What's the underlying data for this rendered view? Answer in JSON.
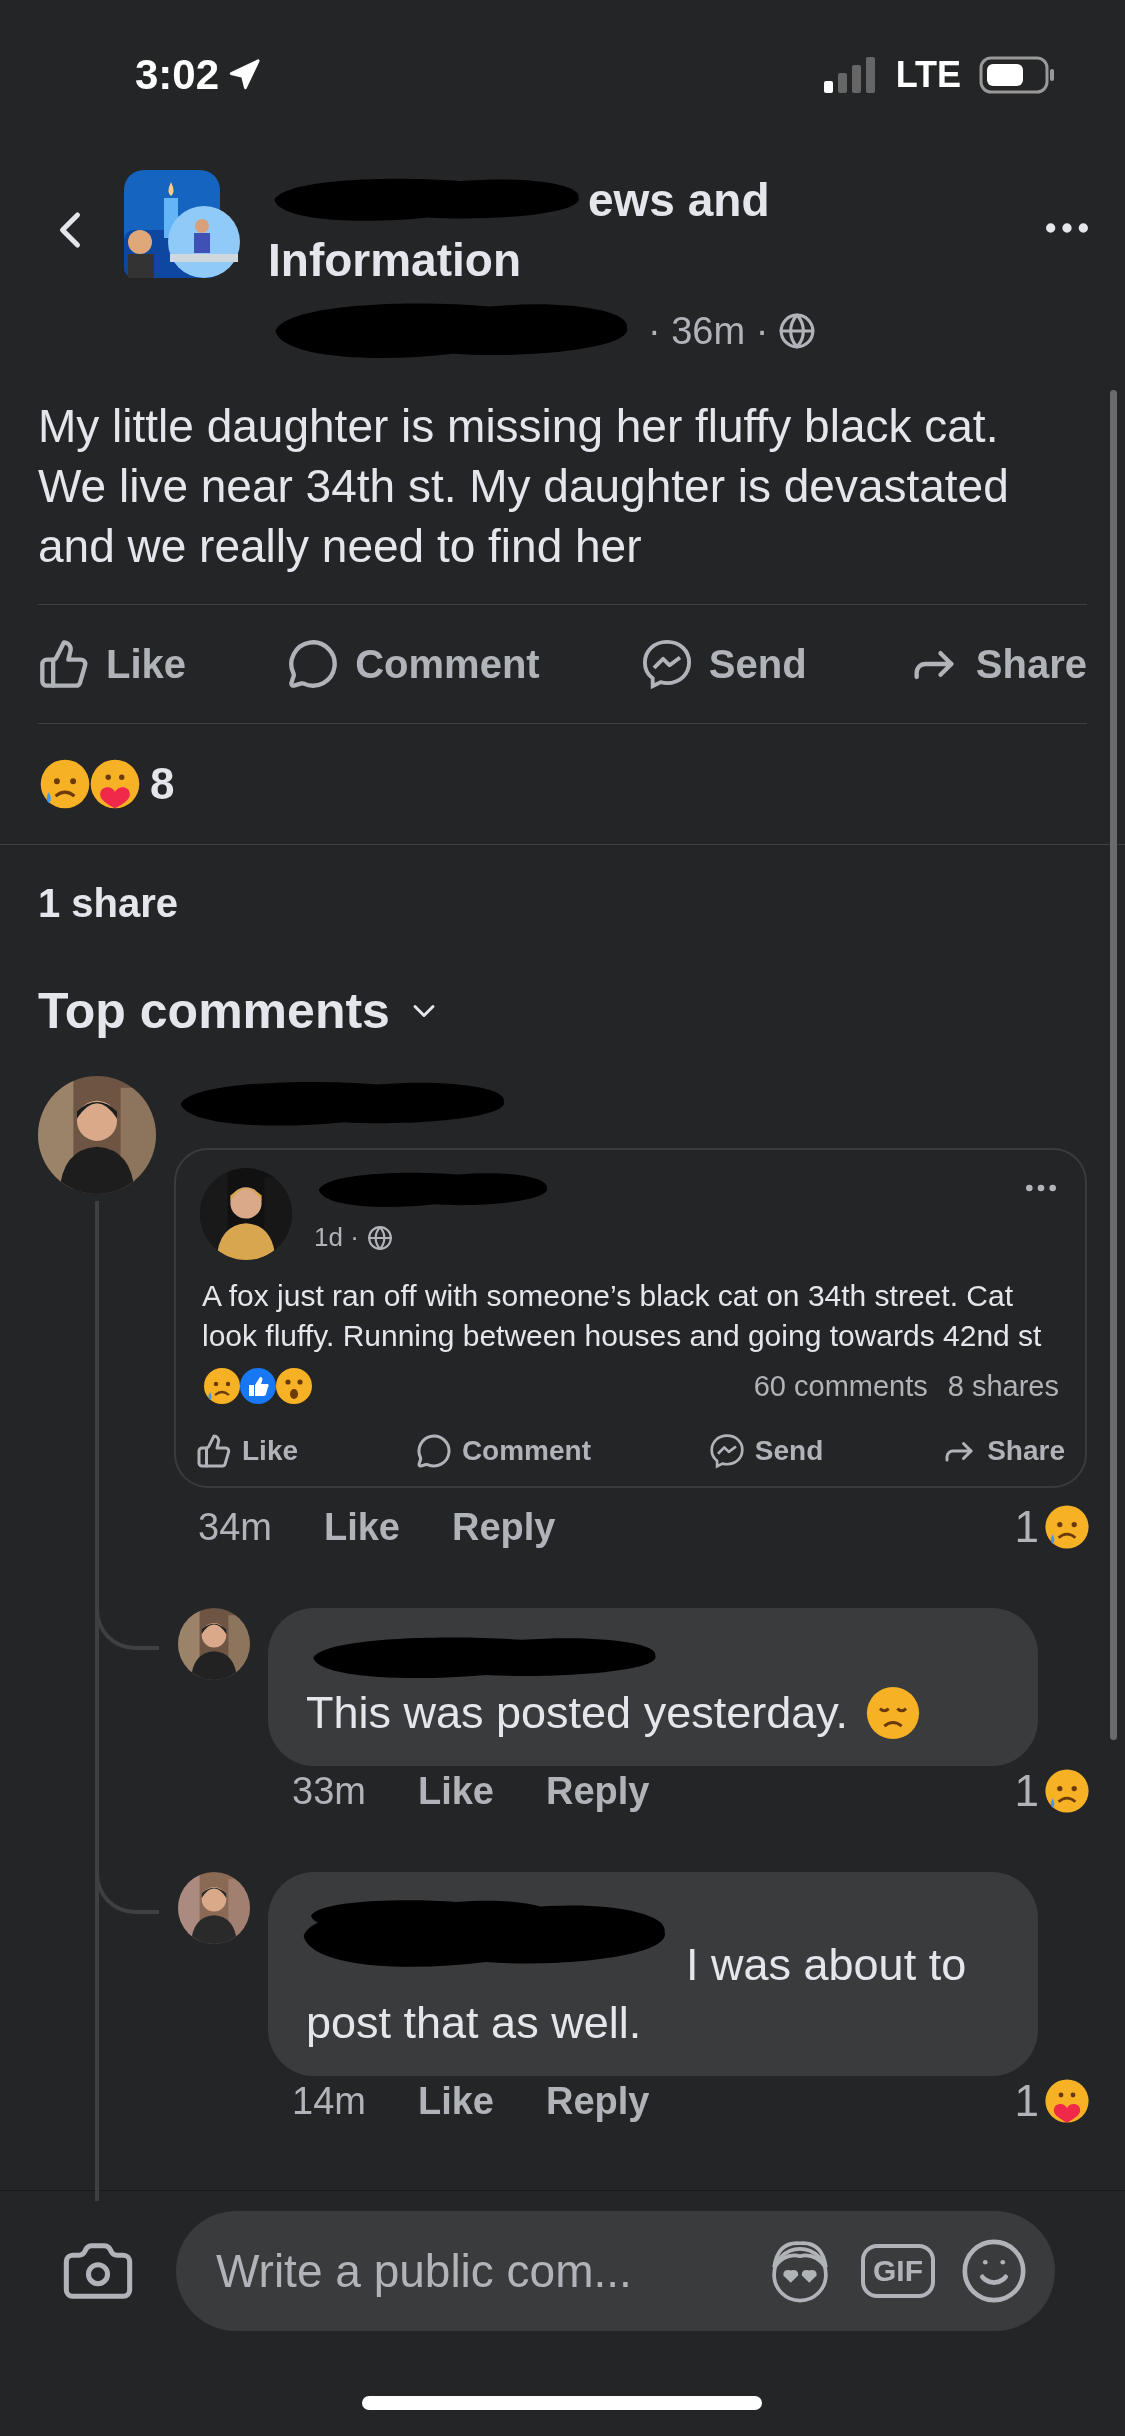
{
  "status_bar": {
    "time": "3:02",
    "network": "LTE"
  },
  "header": {
    "title_lines": [
      "ews and",
      "Information"
    ],
    "meta": "· 36m ·"
  },
  "post": {
    "text": "My little daughter is missing her fluffy black cat. We live near 34th st. My daughter is devastated and we really need to find her",
    "actions": [
      {
        "kind": "like",
        "label": "Like"
      },
      {
        "kind": "comment",
        "label": "Comment"
      },
      {
        "kind": "send",
        "label": "Send"
      },
      {
        "kind": "share",
        "label": "Share"
      }
    ],
    "reactions": [
      {
        "kind": "sad"
      },
      {
        "kind": "care"
      }
    ],
    "reaction_count": "8",
    "shares": "1 share"
  },
  "comments_heading": "Top comments",
  "comments": [
    {
      "kind": "shared",
      "time": "34m",
      "like": "Like",
      "reply": "Reply",
      "reaction_count": "1",
      "reactions": [
        {
          "kind": "sad"
        }
      ],
      "shared_post": {
        "time": "1d ·",
        "text": "A fox just ran off with someone’s black cat on 34th street. Cat look fluffy. Running between houses and going towards 42nd st",
        "reactions": [
          {
            "kind": "sad"
          },
          {
            "kind": "like"
          },
          {
            "kind": "wow"
          }
        ],
        "comments": "60 comments",
        "shares": "8 shares",
        "actions": [
          {
            "kind": "like",
            "label": "Like"
          },
          {
            "kind": "comment",
            "label": "Comment"
          },
          {
            "kind": "send",
            "label": "Send"
          },
          {
            "kind": "share",
            "label": "Share"
          }
        ]
      }
    },
    {
      "kind": "reply",
      "text": "This was posted yesterday.",
      "trailing_emoji": {
        "kind": "disappointed"
      },
      "time": "33m",
      "like": "Like",
      "reply": "Reply",
      "reaction_count": "1",
      "reactions": [
        {
          "kind": "sad"
        }
      ]
    },
    {
      "kind": "reply",
      "text": "I was about to post that as well.",
      "time": "14m",
      "like": "Like",
      "reply": "Reply",
      "reaction_count": "1",
      "reactions": [
        {
          "kind": "care"
        }
      ]
    }
  ],
  "composer": {
    "placeholder": "Write a public com...",
    "gif_label": "GIF"
  }
}
